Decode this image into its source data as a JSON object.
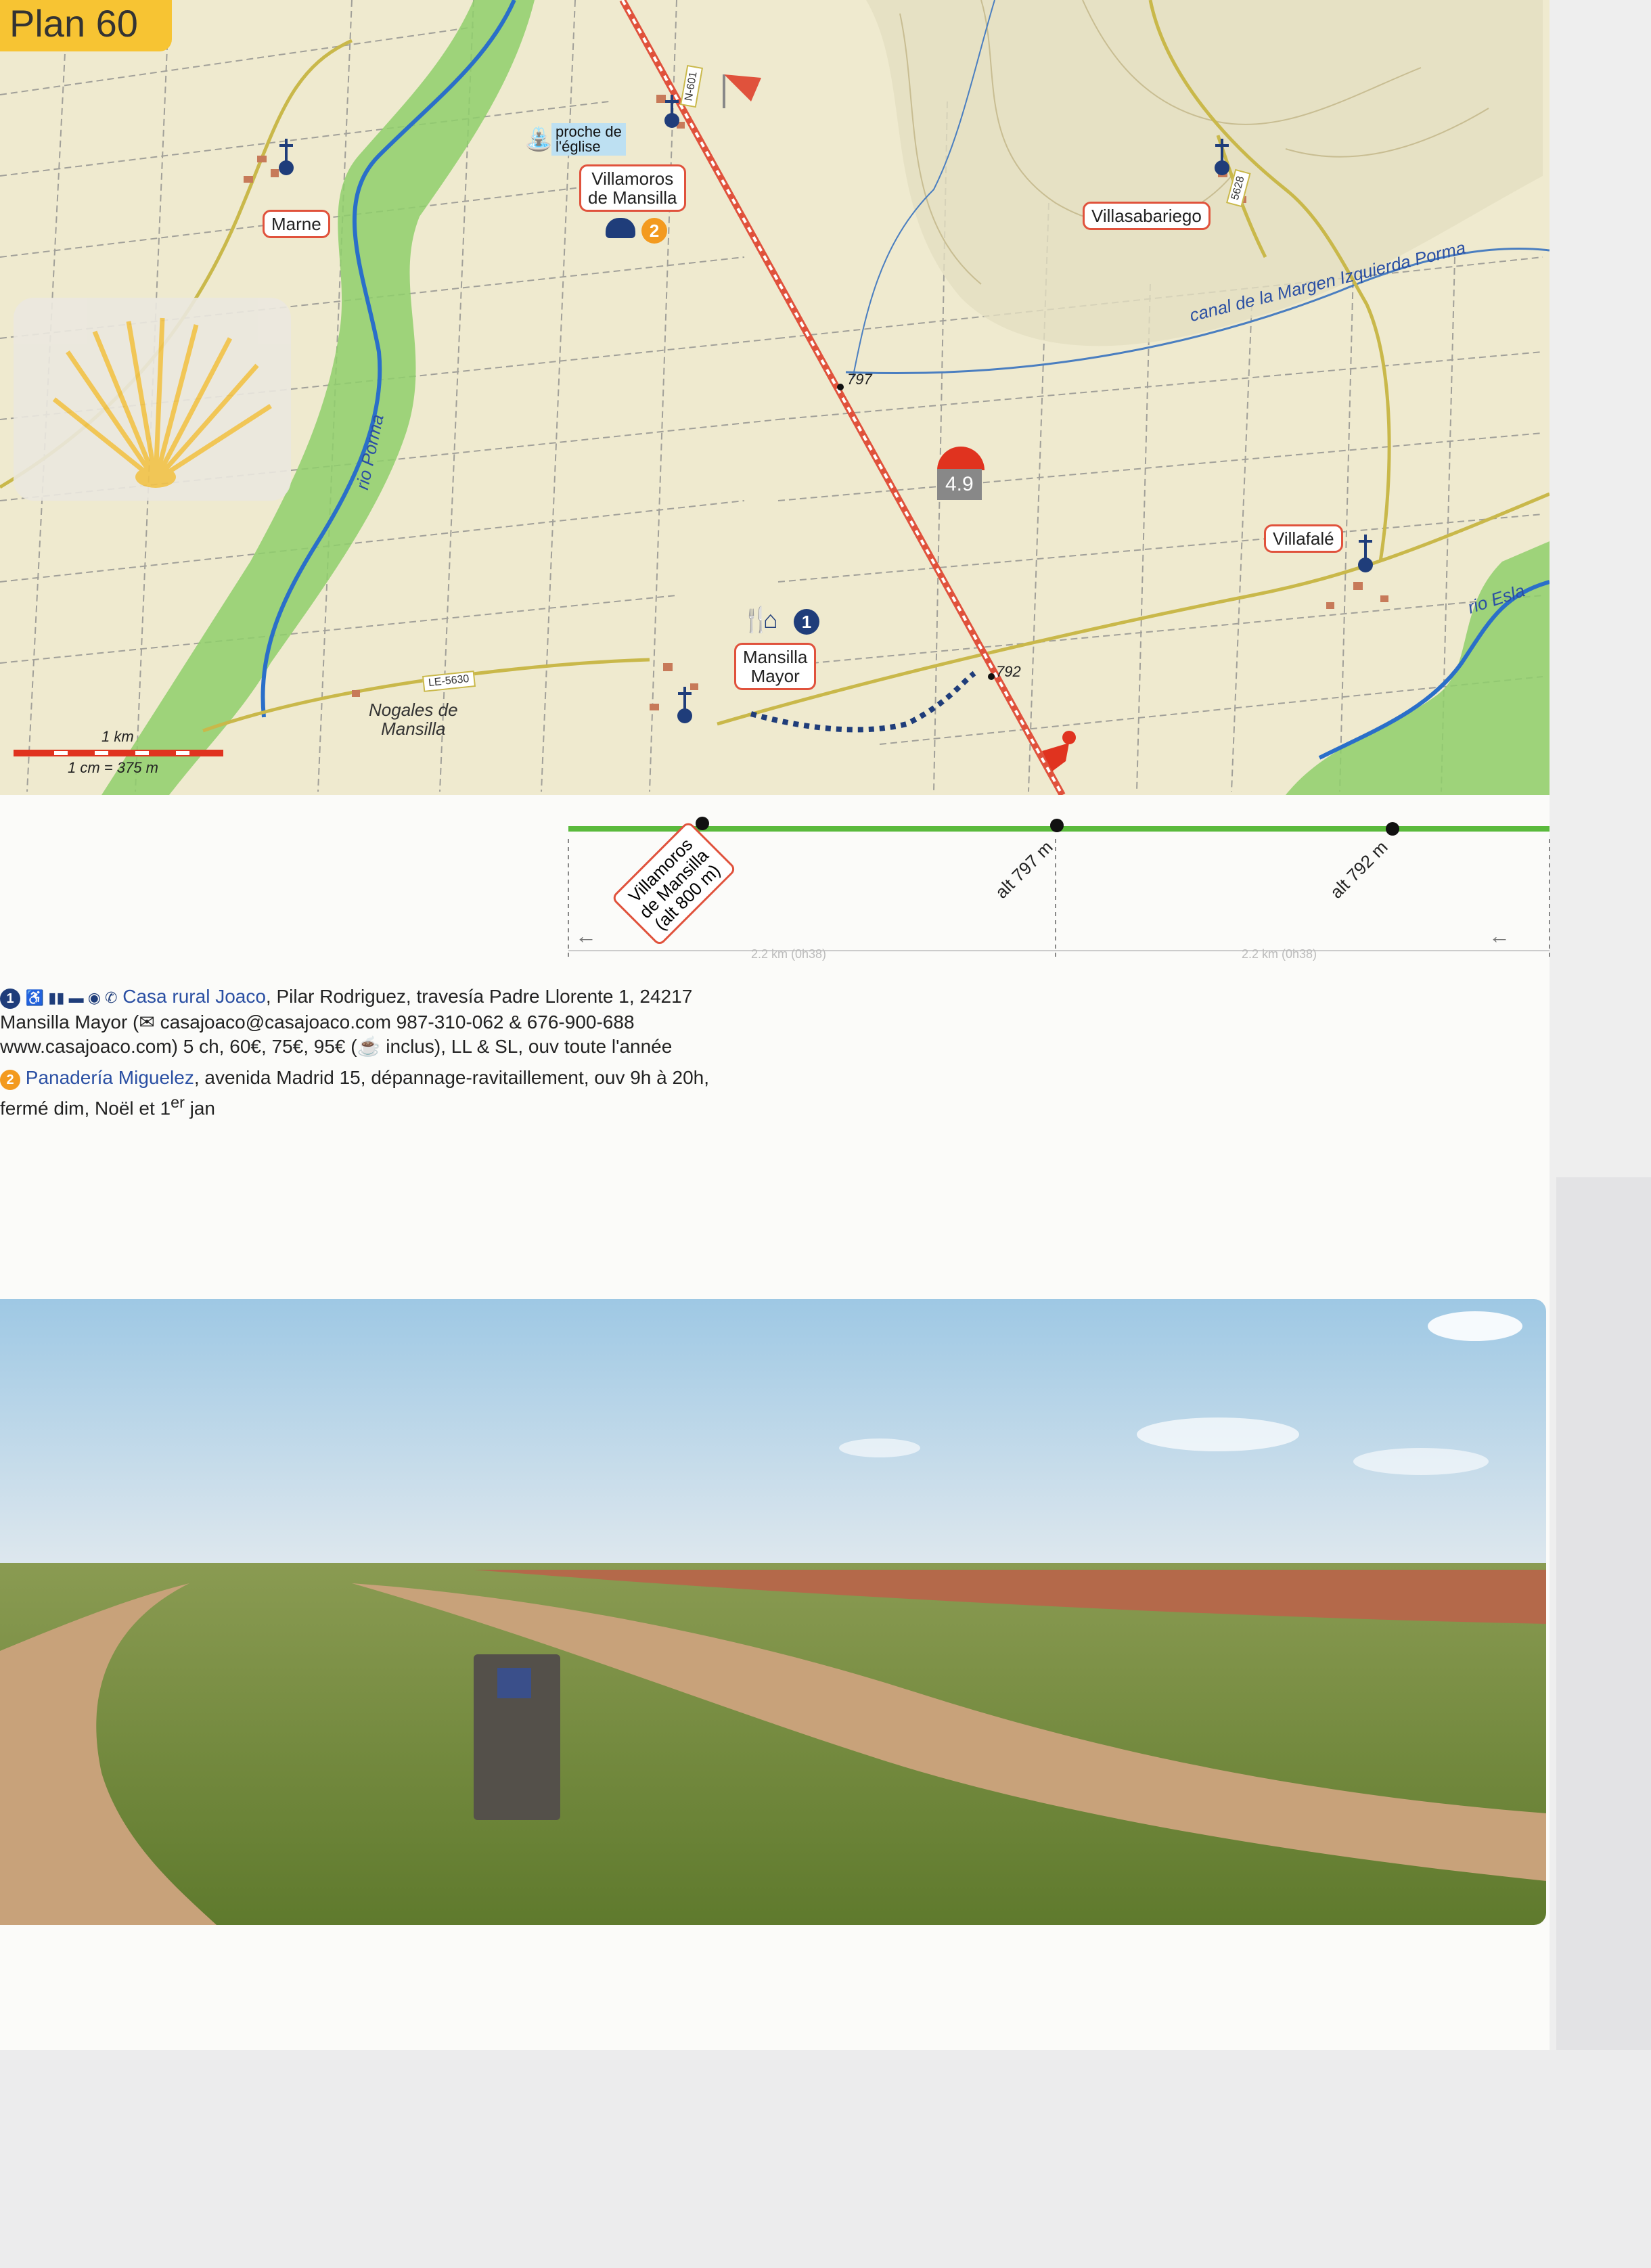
{
  "plan": {
    "label": "Plan 60"
  },
  "map": {
    "places": [
      {
        "key": "marne",
        "label": "Marne"
      },
      {
        "key": "villamoros",
        "label": "Villamoros\nde Mansilla"
      },
      {
        "key": "villasabariego",
        "label": "Villasabariego"
      },
      {
        "key": "villafale",
        "label": "Villafalé"
      },
      {
        "key": "mansilla_mayor",
        "label": "Mansilla\nMayor"
      },
      {
        "key": "nogales",
        "label": "Nogales de\nMansilla"
      }
    ],
    "water_note": "proche de\nl'église",
    "rivers": {
      "porma": "rio Porma",
      "esla": "rio Esla",
      "canal": "canal de la Margen Izquierda Porma"
    },
    "roads": {
      "le5630": "LE-5630",
      "n601": "N-601",
      "le5628": "5628"
    },
    "altitude_points": {
      "a797": "797",
      "a792": "792"
    },
    "km_marker": "4.9",
    "badges": {
      "one": "1",
      "two": "2"
    },
    "scale": {
      "km": "1 km",
      "ratio": "1 cm = 375 m"
    },
    "icons": [
      "church-icon",
      "water-tap-icon",
      "bakery-icon",
      "restaurant-icon",
      "bed-icon",
      "scallop-shell-icon",
      "walker-icon",
      "flag-icon"
    ],
    "colors": {
      "route": "#e0523c",
      "river": "#2a6fc9",
      "green_zone": "#8fcf6b",
      "land": "#efeacf"
    }
  },
  "profile": {
    "start_label": "Villamoros\nde Mansilla\n(alt 800 m)",
    "alt1": "alt 797 m",
    "alt2": "alt 792 m",
    "dist1": "2.2 km (0h38)",
    "dist2": "2.2 km (0h38)",
    "arrow_left": "←",
    "arrow_right": "←"
  },
  "entries": [
    {
      "num": "1",
      "title": "Casa rural Joaco",
      "text_1": ", Pilar Rodriguez, travesía Padre Llorente 1, 24217 Mansilla Mayor (",
      "email": "casajoaco@casajoaco.com",
      "text_2": " 987-310-062 & 676-900-688 www.casajoaco.com) 5 ch, 60€, 75€, 95€ (",
      "text_3": "inclus), LL & SL, ouv toute l'année"
    },
    {
      "num": "2",
      "title": "Panadería Miguelez",
      "text_1": ", avenida Madrid 15, dépannage-ravitaillement, ouv 9h à 20h, fermé dim, Noël et ",
      "sup_pre": "1",
      "sup": "er",
      "text_2": " jan"
    }
  ]
}
